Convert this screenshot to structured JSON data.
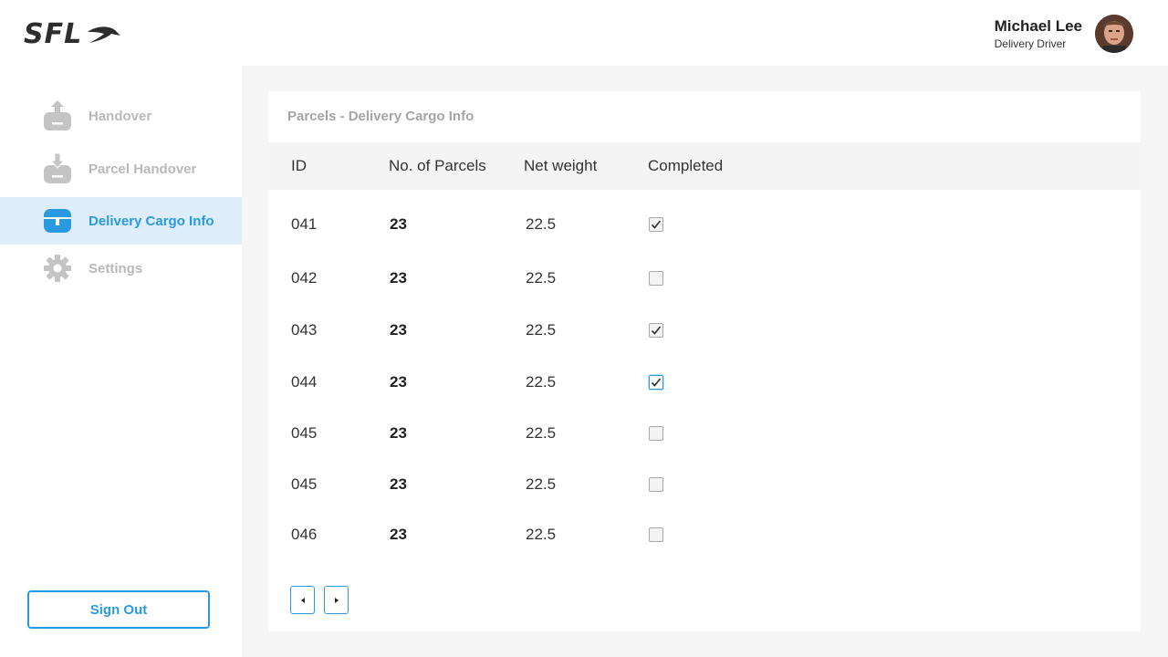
{
  "header": {
    "logo_text": "SFL",
    "user": {
      "name": "Michael Lee",
      "role": "Delivery Driver"
    }
  },
  "sidebar": {
    "items": [
      {
        "label": "Handover",
        "icon": "box-upload-icon",
        "active": false
      },
      {
        "label": "Parcel Handover",
        "icon": "box-download-icon",
        "active": false
      },
      {
        "label": "Delivery Cargo Info",
        "icon": "cargo-box-icon",
        "active": true
      },
      {
        "label": "Settings",
        "icon": "gear-icon",
        "active": false
      }
    ],
    "signout_label": "Sign Out"
  },
  "main": {
    "card_title": "Parcels - Delivery Cargo Info",
    "columns": [
      "ID",
      "No. of Parcels",
      "Net weight",
      "Completed"
    ],
    "rows": [
      {
        "id": "041",
        "parcels": "23",
        "weight": "22.5",
        "completed": true
      },
      {
        "id": "042",
        "parcels": "23",
        "weight": "22.5",
        "completed": false
      },
      {
        "id": "043",
        "parcels": "23",
        "weight": "22.5",
        "completed": true
      },
      {
        "id": "044",
        "parcels": "23",
        "weight": "22.5",
        "completed": true
      },
      {
        "id": "045",
        "parcels": "23",
        "weight": "22.5",
        "completed": false
      },
      {
        "id": "045",
        "parcels": "23",
        "weight": "22.5",
        "completed": false
      },
      {
        "id": "046",
        "parcels": "23",
        "weight": "22.5",
        "completed": false
      }
    ],
    "pager": {
      "prev_icon": "caret-left-icon",
      "next_icon": "caret-right-icon"
    }
  },
  "colors": {
    "accent": "#2a9ae0",
    "active_bg": "#ddeefa",
    "muted": "#b9b9b9"
  }
}
